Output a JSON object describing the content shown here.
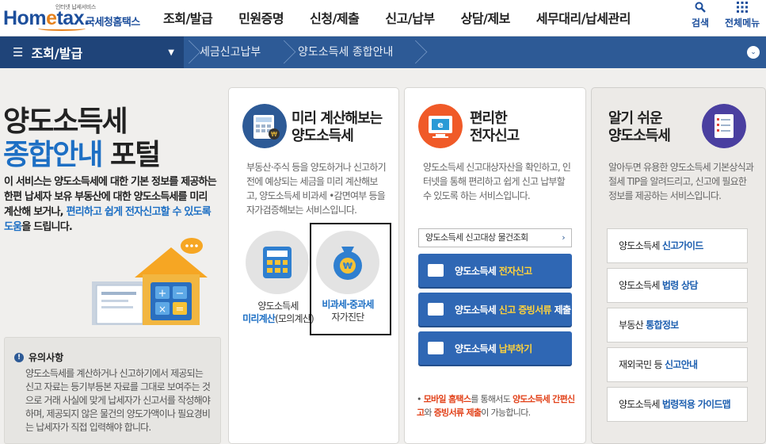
{
  "header": {
    "logo_small": "인터넷 납세서비스",
    "logo_main_a": "Hom",
    "logo_main_b": "e",
    "logo_main_c": "tax.",
    "logo_kr": "국세청홈택스",
    "nav": [
      "조회/발급",
      "민원증명",
      "신청/제출",
      "신고/납부",
      "상담/제보",
      "세무대리/납세관리"
    ],
    "search_label": "검색",
    "all_menu_label": "전체메뉴"
  },
  "locbar": {
    "menu_label": "조회/발급",
    "crumb1": "세금신고납부",
    "crumb2": "양도소득세 종합안내"
  },
  "intro": {
    "title_line1": "양도소득세",
    "title_line2_blue": "종합안내",
    "title_line2_rest": " 포털",
    "desc_a": "이 서비스는 양도소득세에 대한 기본 정보를 제공하는 한편 납세자 보유 부동산에 대한 양도소득세를 미리 계산해 보거나, ",
    "desc_blue": "편리하고 쉽게 전자신고할 수 있도록 도움",
    "desc_end": "을 드립니다."
  },
  "notice": {
    "title": "유의사항",
    "body": "양도소득세를 계산하거나 신고하기에서 제공되는 신고 자료는 등기부등본 자료를 그대로 보여주는 것으로 거래 사실에 맞게 납세자가 신고서를 작성해야 하며, 제공되지 않은 물건의 양도가액이나 필요경비는 납세자가 직접 입력해야 합니다."
  },
  "card1": {
    "title_line1": "미리 계산해보는",
    "title_line2": "양도소득세",
    "desc": "부동산·주식 등을 양도하거나 신고하기 전에 예상되는 세금을 미리 계산해보고, 양도소득세 비과세 •감면여부 등을 자가검증해보는 서비스입니다.",
    "btn1_line1": "양도소득세",
    "btn1_line2": "미리계산",
    "btn1_line2b": "(모의계산)",
    "btn2_line1": "비과세·중과세",
    "btn2_line2": "자가진단"
  },
  "card2": {
    "title_line1": "편리한",
    "title_line2": "전자신고",
    "desc": "양도소득세 신고대상자산을 확인하고, 인터넷을 통해 편리하고 쉽게 신고 납부할 수 있도록 하는 서비스입니다.",
    "lookup": "양도소득세 신고대상 물건조회",
    "btn1_a": "양도소득세 ",
    "btn1_b": "전자신고",
    "btn2_a": "양도소득세 ",
    "btn2_b": "신고 증빙서류",
    "btn2_c": " 제출",
    "btn3_a": "양도소득세 ",
    "btn3_b": "납부하기",
    "note_a": "• ",
    "note_red1": "모바일 홈택스",
    "note_b": "를 통해서도 ",
    "note_red2": "양도소득세 간편신고",
    "note_c": "와 ",
    "note_red3": "증빙서류 제출",
    "note_d": "이 가능합니다."
  },
  "card3": {
    "title_line1": "알기 쉬운",
    "title_line2": "양도소득세",
    "desc": "알아두면 유용한 양도소득세 기본상식과 절세 TIP을 알려드리고, 신고에 필요한 정보를 제공하는 서비스입니다.",
    "items": [
      {
        "a": "양도소득세 ",
        "b": "신고가이드"
      },
      {
        "a": "양도소득세 ",
        "b": "법령 상담"
      },
      {
        "a": "부동산 ",
        "b": "통합정보"
      },
      {
        "a": "재외국민 등 ",
        "b": "신고안내"
      },
      {
        "a": "양도소득세 ",
        "b": "법령적용 가이드맵"
      }
    ]
  },
  "colors": {
    "brand_blue": "#1d4f9c",
    "nav_bar": "#2d5a96",
    "button_blue": "#2f67b4",
    "accent_orange": "#e5811c",
    "highlight_yellow": "#ffd23c",
    "note_red": "#e2421a"
  }
}
